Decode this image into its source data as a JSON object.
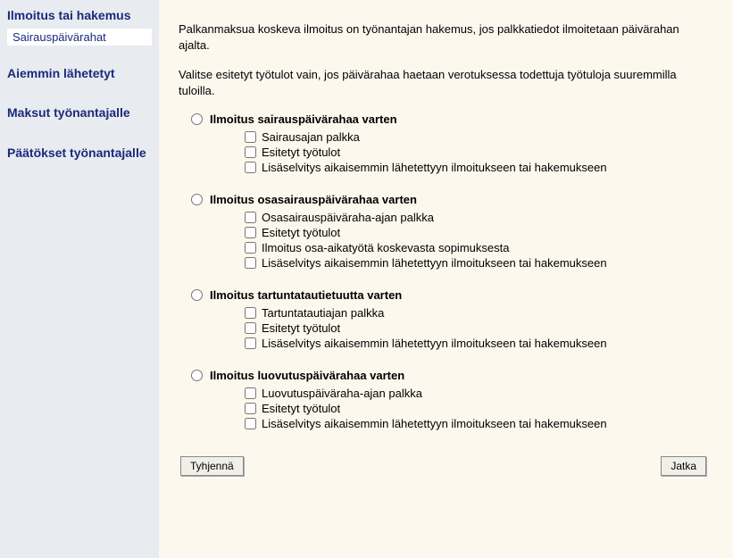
{
  "sidebar": {
    "nav": [
      {
        "label": "Ilmoitus tai hakemus",
        "sub": "Sairauspäivärahat"
      },
      {
        "label": "Aiemmin lähetetyt"
      },
      {
        "label": "Maksut työnantajalle"
      },
      {
        "label": "Päätökset työnantajalle"
      }
    ]
  },
  "main": {
    "intro1": "Palkanmaksua koskeva ilmoitus on työnantajan hakemus, jos palkkatiedot ilmoitetaan päivärahan ajalta.",
    "intro2": "Valitse esitetyt työtulot vain, jos päivärahaa haetaan verotuksessa todettuja työtuloja suuremmilla tuloilla.",
    "groups": [
      {
        "title": "Ilmoitus sairauspäivärahaa varten",
        "options": [
          "Sairausajan palkka",
          "Esitetyt työtulot",
          "Lisäselvitys aikaisemmin lähetettyyn ilmoitukseen tai hakemukseen"
        ]
      },
      {
        "title": "Ilmoitus osasairauspäivärahaa varten",
        "options": [
          "Osasairauspäiväraha-ajan palkka",
          "Esitetyt työtulot",
          "Ilmoitus osa-aikatyötä koskevasta sopimuksesta",
          "Lisäselvitys aikaisemmin lähetettyyn ilmoitukseen tai hakemukseen"
        ]
      },
      {
        "title": "Ilmoitus tartuntatautietuutta varten",
        "options": [
          "Tartuntatautiajan palkka",
          "Esitetyt työtulot",
          "Lisäselvitys aikaisemmin lähetettyyn ilmoitukseen tai hakemukseen"
        ]
      },
      {
        "title": "Ilmoitus luovutuspäivärahaa varten",
        "options": [
          "Luovutuspäiväraha-ajan palkka",
          "Esitetyt työtulot",
          "Lisäselvitys aikaisemmin lähetettyyn ilmoitukseen tai hakemukseen"
        ]
      }
    ],
    "buttons": {
      "clear": "Tyhjennä",
      "continue": "Jatka"
    }
  }
}
